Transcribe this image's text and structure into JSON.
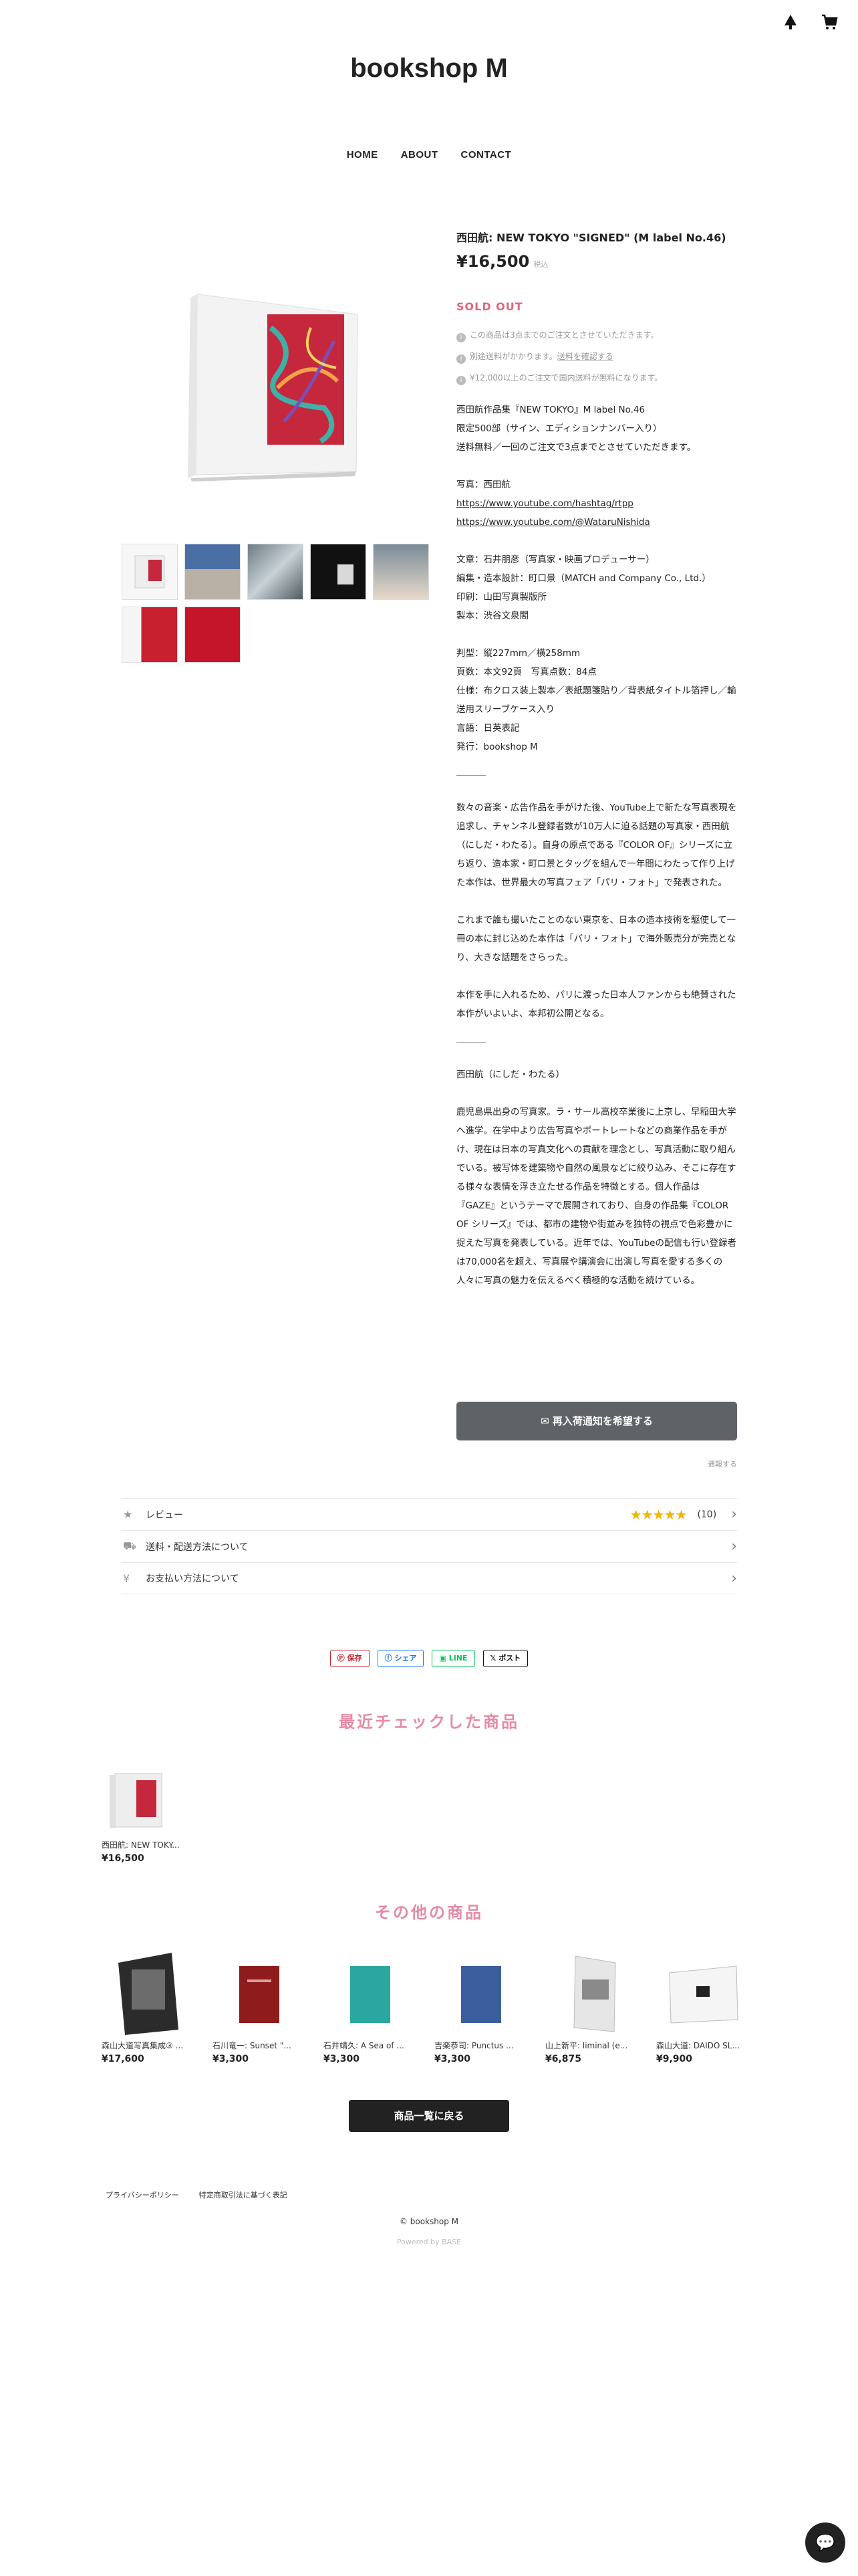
{
  "header": {
    "shop_name": "bookshop M",
    "icons": [
      "user-icon",
      "cart-icon"
    ],
    "nav": [
      "HOME",
      "ABOUT",
      "CONTACT"
    ]
  },
  "product": {
    "title": "西田航: NEW TOKYO \"SIGNED\" (M label No.46)",
    "price": "¥16,500",
    "tax_label": "税込",
    "status": "SOLD OUT",
    "notes": [
      "この商品は3点までのご注文とさせていただきます。",
      "別途送料がかかります。",
      "送料を確認する",
      "¥12,000以上のご注文で国内送料が無料になります。"
    ],
    "desc_block1": [
      "西田航作品集『NEW TOKYO』M label No.46",
      "限定500部（サイン、エディションナンバー入り）",
      "送料無料／一回のご注文で3点までとさせていただきます。"
    ],
    "desc_block2": [
      "写真：西田航",
      "https://www.youtube.com/hashtag/rtpp",
      "https://www.youtube.com/@WataruNishida"
    ],
    "desc_block3": [
      "文章：石井朋彦（写真家・映画プロデューサー）",
      "編集・造本設計：町口景（MATCH and Company Co., Ltd.）",
      "印刷：山田写真製版所",
      "製本：渋谷文泉閣"
    ],
    "desc_block4": [
      "判型：縦227mm／横258mm",
      "頁数：本文92頁　写真点数：84点",
      "仕様：布クロス装上製本／表紙題箋貼り／背表紙タイトル箔押し／輸送用スリーブケース入り",
      "言語：日英表記",
      "発行：bookshop M"
    ],
    "desc_para1": "数々の音楽・広告作品を手がけた後、YouTube上で新たな写真表現を追求し、チャンネル登録者数が10万人に迫る話題の写真家・西田航（にしだ・わたる）。自身の原点である『COLOR OF』シリーズに立ち返り、造本家・町口景とタッグを組んで一年間にわたって作り上げた本作は、世界最大の写真フェア「パリ・フォト」で発表された。",
    "desc_para2": "これまで誰も撮いたことのない東京を、日本の造本技術を駆使して一冊の本に封じ込めた本作は「パリ・フォト」で海外販売分が完売となり、大きな話題をさらった。",
    "desc_para3": "本作を手に入れるため、パリに渡った日本人ファンからも絶賛された本作がいよいよ、本邦初公開となる。",
    "bio_name": "西田航（にしだ・わたる）",
    "bio_para": "鹿児島県出身の写真家。ラ・サール高校卒業後に上京し、早稲田大学へ進学。在学中より広告写真やポートレートなどの商業作品を手がけ、現在は日本の写真文化への貢献を理念とし、写真活動に取り組んでいる。被写体を建築物や自然の風景などに絞り込み、そこに存在する様々な表情を浮き立たせる作品を特徴とする。個人作品は『GAZE』というテーマで展開されており、自身の作品集『COLOR OF シリーズ』では、都市の建物や街並みを独特の視点で色彩豊かに捉えた写真を発表している。近年では、YouTubeの配信も行い登録者は70,000名を超え、写真展や講演会に出演し写真を愛する多くの人々に写真の魅力を伝えるべく積極的な活動を続けている。",
    "notify_button": "再入荷通知を希望する",
    "notify_icon": "mail-icon",
    "notify_small": "通報する"
  },
  "info_rows": [
    {
      "icon": "star-icon",
      "label": "レビュー",
      "rating_stars": "★★★★★",
      "rating": 4.7,
      "count": "(10)"
    },
    {
      "icon": "truck-icon",
      "label": "送料・配送方法について"
    },
    {
      "icon": "coin-icon",
      "label": "お支払い方法について"
    }
  ],
  "share": [
    "保存",
    "シェア",
    "LINE",
    "ポスト"
  ],
  "recent_title": "最近チェックした商品",
  "recent_item": {
    "name": "西田航: NEW TOKY...",
    "price": "¥16,500"
  },
  "others_title": "その他の商品",
  "others": [
    {
      "name": "森山大道写真集成③ ...",
      "price": "¥17,600",
      "color": "#2b2b2b"
    },
    {
      "name": "石川竜一: Sunset \"...",
      "price": "¥3,300",
      "color": "#8e1c1c"
    },
    {
      "name": "石井靖久: A Sea of ...",
      "price": "¥3,300",
      "color": "#2ba7a0"
    },
    {
      "name": "吉楽恭司: Punctus ...",
      "price": "¥3,300",
      "color": "#3b5f9c"
    },
    {
      "name": "山上新平: liminal (e...",
      "price": "¥6,875",
      "color": "#d9d9d9"
    },
    {
      "name": "森山大道: DAIDO SL...",
      "price": "¥9,900",
      "color": "#f3f3f3"
    }
  ],
  "back_button": "商品一覧に戻る",
  "footer": {
    "links": [
      "プライバシーポリシー",
      "特定商取引法に基づく表記"
    ],
    "copyright": "© bookshop M",
    "powered": "Powered by BASE"
  },
  "colors": {
    "accent": "#e78aa6",
    "soldout": "#e2667d",
    "button": "#5f6368",
    "dark": "#222222"
  }
}
